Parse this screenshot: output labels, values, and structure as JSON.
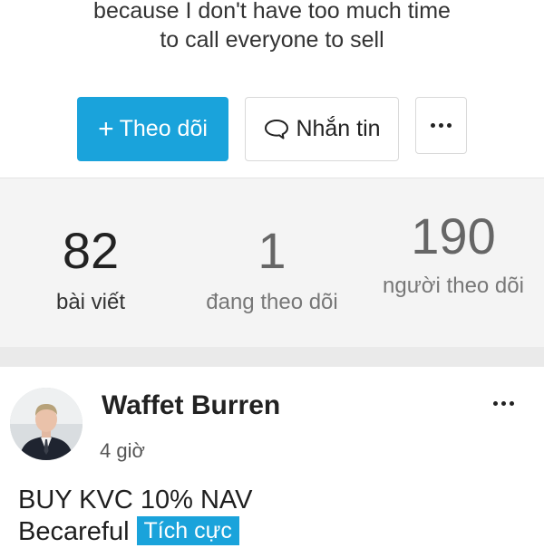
{
  "profile": {
    "bio_line1": "because I don't have too much time",
    "bio_line2": "to call everyone to sell"
  },
  "actions": {
    "follow_label": "Theo dõi",
    "follow_plus": "+",
    "message_label": "Nhắn tin",
    "more_icon": "more-horizontal-icon"
  },
  "stats": {
    "posts_count": "82",
    "posts_label": "bài viết",
    "following_count": "1",
    "following_label": "đang theo dõi",
    "followers_count": "190",
    "followers_label": "người theo dõi"
  },
  "post": {
    "author": "Waffet Burren",
    "time": "4 giờ",
    "text_line1": "BUY KVC 10% NAV",
    "text_line2": "Becareful",
    "tag": "Tích cực"
  },
  "colors": {
    "accent": "#1aa3db",
    "stats_bg": "#f4f4f4"
  }
}
